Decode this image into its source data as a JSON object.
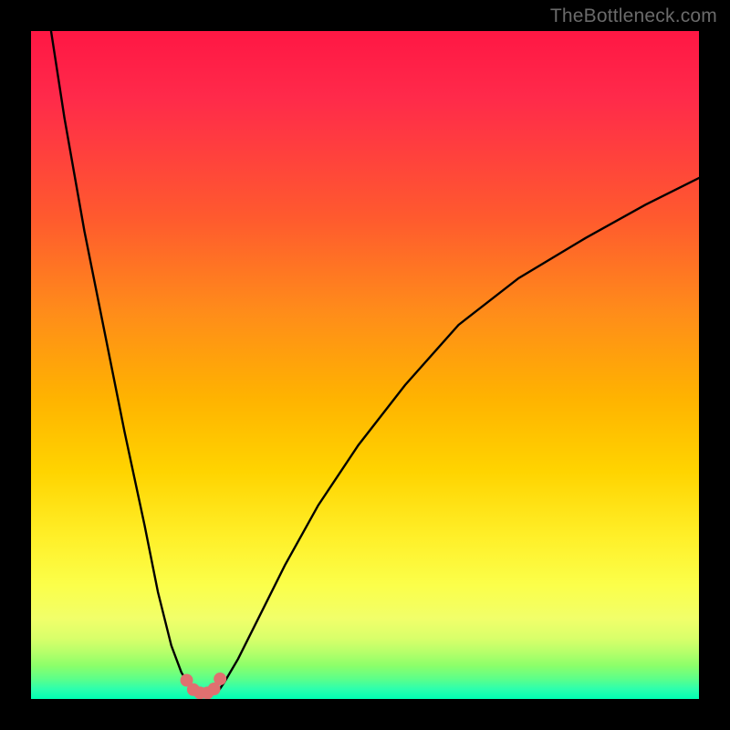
{
  "watermark": {
    "text": "TheBottleneck.com"
  },
  "chart_data": {
    "type": "line",
    "title": "",
    "xlabel": "",
    "ylabel": "",
    "xlim": [
      0,
      100
    ],
    "ylim": [
      0,
      100
    ],
    "grid": false,
    "series": [
      {
        "name": "curve",
        "x": [
          3,
          5,
          8,
          11,
          14,
          17,
          19,
          21,
          22.5,
          24,
          25,
          26,
          27,
          28,
          29,
          31,
          34,
          38,
          43,
          49,
          56,
          64,
          73,
          83,
          92,
          100
        ],
        "y": [
          100,
          87,
          70,
          55,
          40,
          26,
          16,
          8,
          4,
          1.5,
          0.7,
          0.5,
          0.6,
          1.1,
          2.6,
          6,
          12,
          20,
          29,
          38,
          47,
          56,
          63,
          69,
          74,
          78
        ]
      }
    ],
    "markers": [
      {
        "x": 23.3,
        "y": 2.8
      },
      {
        "x": 24.3,
        "y": 1.4
      },
      {
        "x": 25.3,
        "y": 0.9
      },
      {
        "x": 26.4,
        "y": 0.9
      },
      {
        "x": 27.4,
        "y": 1.5
      },
      {
        "x": 28.3,
        "y": 3.0
      }
    ],
    "colors": {
      "curve": "#000000",
      "markers": "#e07070",
      "gradient_top": "#ff1744",
      "gradient_bottom": "#00ffb3"
    }
  }
}
